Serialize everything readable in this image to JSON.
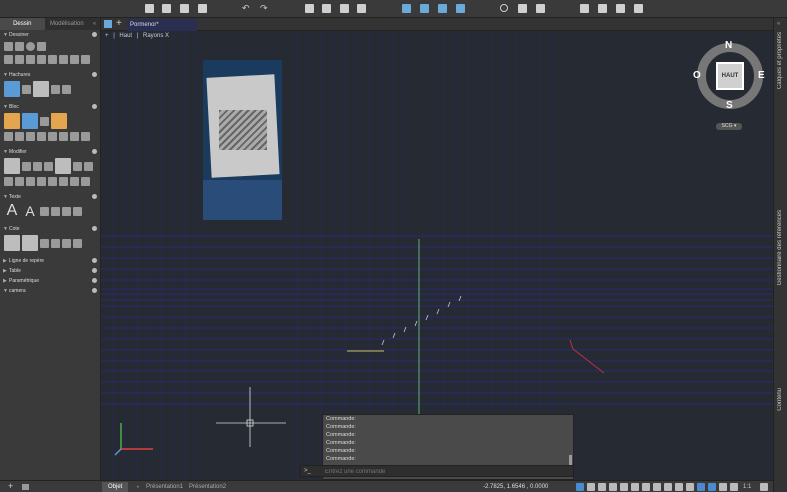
{
  "left_panel": {
    "tabs": [
      "Dessin",
      "Modélisation"
    ],
    "sections": [
      "Dessiner",
      "Hachures",
      "Bloc",
      "Modifier",
      "Texte",
      "Cote",
      "Ligne de repère",
      "Table",
      "Paramétrique",
      "camera"
    ]
  },
  "doc_tab": "Pormenor*",
  "viewport": {
    "view_name": "Haut",
    "style_name": "Rayons X"
  },
  "viewcube": {
    "face": "HAUT",
    "north": "N",
    "south": "S",
    "east": "E",
    "west": "O",
    "ucs": "SCG"
  },
  "command": {
    "history": [
      "Commande:",
      "Commande:",
      "Commande:",
      "Commande:",
      "Commande:",
      "Commande:"
    ],
    "placeholder": "Entrez une commande",
    "prompt": ">_"
  },
  "right_panel": [
    "Calques et propriétés",
    "Gestionnaire des références",
    "Contenu"
  ],
  "status": {
    "tabs": [
      "Objet",
      "Présentation1",
      "Présentation2"
    ],
    "coords": "-2.7825,   1.6546   , 0.0000",
    "scale": "1:1"
  },
  "colors": {
    "viewport_bg": "#262a33",
    "grid": "#2a2a7a",
    "accent": "#4a8ad1"
  }
}
